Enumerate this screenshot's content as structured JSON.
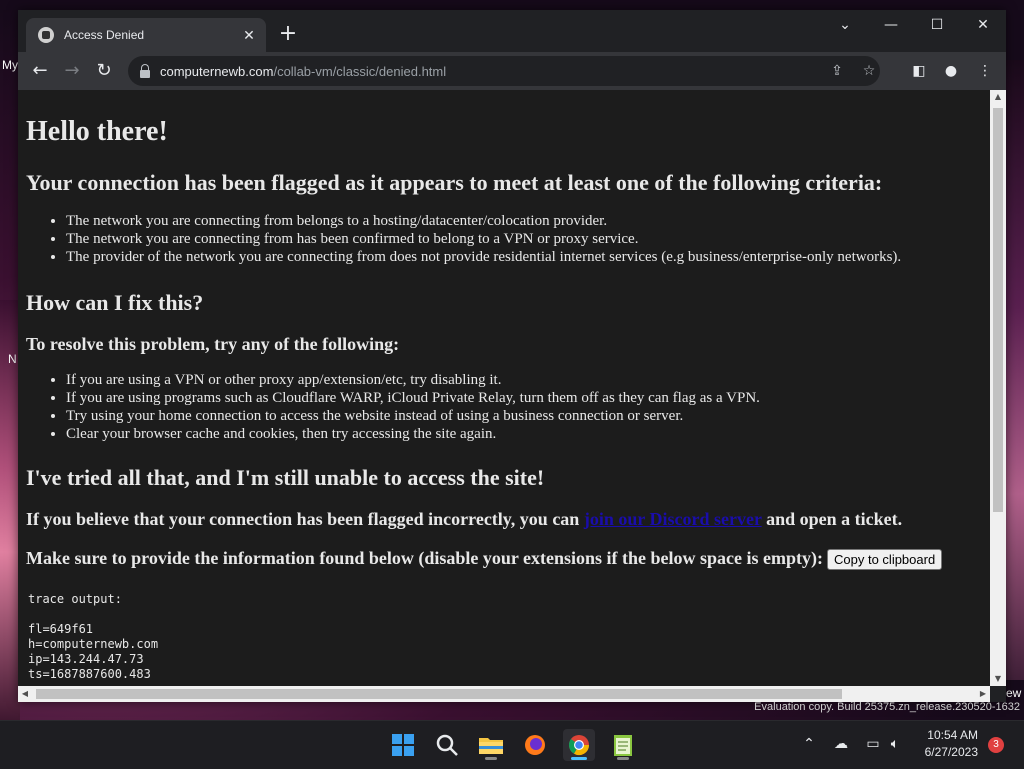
{
  "desktop": {
    "left_labels": [
      "My",
      "N"
    ],
    "right_label": "ew",
    "watermark": "Evaluation copy. Build 25375.zn_release.230520-1632"
  },
  "browser": {
    "tab_title": "Access Denied",
    "url_host": "computernewb.com",
    "url_path": "/collab-vm/classic/denied.html"
  },
  "page": {
    "h1": "Hello there!",
    "h2_criteria": "Your connection has been flagged as it appears to meet at least one of the following criteria:",
    "criteria": [
      "The network you are connecting from belongs to a hosting/datacenter/colocation provider.",
      "The network you are connecting from has been confirmed to belong to a VPN or proxy service.",
      "The provider of the network you are connecting from does not provide residential internet services (e.g business/enterprise-only networks)."
    ],
    "h2_fix": "How can I fix this?",
    "h3_resolve": "To resolve this problem, try any of the following:",
    "fixes": [
      "If you are using a VPN or other proxy app/extension/etc, try disabling it.",
      "If you are using programs such as Cloudflare WARP, iCloud Private Relay, turn them off as they can flag as a VPN.",
      "Try using your home connection to access the website instead of using a business connection or server.",
      "Clear your browser cache and cookies, then try accessing the site again."
    ],
    "h2_tried": "I've tried all that, and I'm still unable to access the site!",
    "ticket_pre": "If you believe that your connection has been flagged incorrectly, you can ",
    "ticket_link": "join our Discord server",
    "ticket_post": " and open a ticket.",
    "info_text": "Make sure to provide the information found below (disable your extensions if the below space is empty):",
    "copy_button": "Copy to clipboard",
    "trace_output": "trace output:\n\nfl=649f61\nh=computernewb.com\nip=143.244.47.73\nts=1687887600.483"
  },
  "taskbar": {
    "time": "10:54 AM",
    "date": "6/27/2023",
    "notification_count": "3"
  }
}
